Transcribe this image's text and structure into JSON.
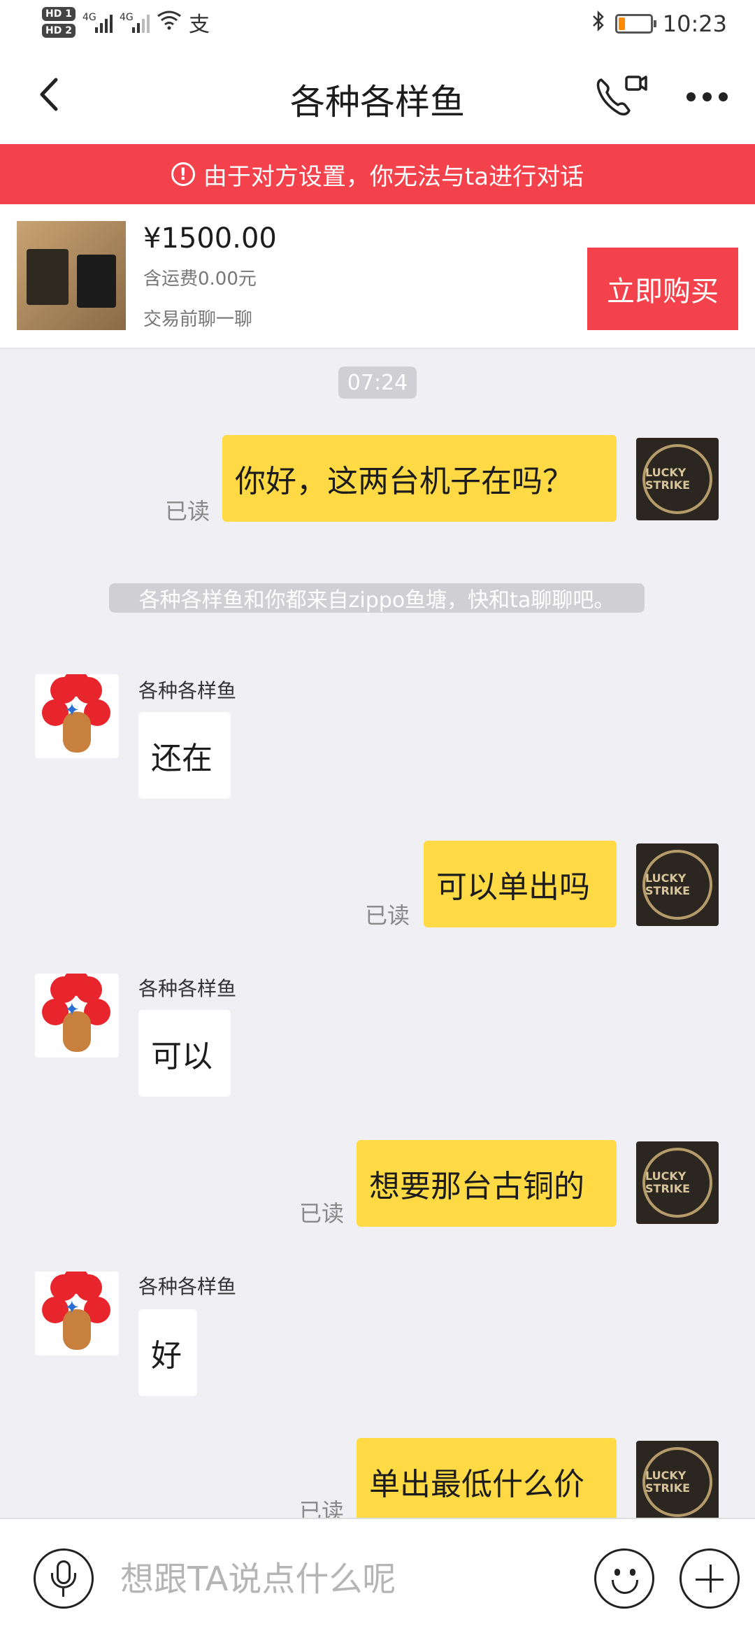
{
  "status_bar": {
    "hd1": "HD 1",
    "hd2": "HD 2",
    "net1": "4G",
    "net2": "4G",
    "alipay_glyph": "支",
    "time": "10:23",
    "battery_level": 0.2,
    "battery_color": "#ff8a00"
  },
  "header": {
    "title": "各种各样鱼",
    "icons": [
      "back-icon",
      "video-call-icon",
      "more-icon"
    ]
  },
  "banner": {
    "icon": "!",
    "text": "由于对方设置，你无法与ta进行对话",
    "color": "#f4424c"
  },
  "product": {
    "price": "¥1500.00",
    "shipping": "含运费0.00元",
    "note": "交易前聊一聊",
    "buy_label": "立即购买"
  },
  "chat": {
    "timestamp": "07:24",
    "system_message": "各种各样鱼和你都来自zippo鱼塘，快和ta聊聊吧。",
    "read_label": "已读",
    "other_name": "各种各样鱼",
    "my_avatar_text": "LUCKY STRIKE",
    "messages": [
      {
        "from": "me",
        "text": "你好，这两台机子在吗？"
      },
      {
        "from": "them",
        "text": "还在"
      },
      {
        "from": "me",
        "text": "可以单出吗"
      },
      {
        "from": "them",
        "text": "可以"
      },
      {
        "from": "me",
        "text": "想要那台古铜的"
      },
      {
        "from": "them",
        "text": "好"
      },
      {
        "from": "me",
        "text": "单出最低什么价"
      }
    ]
  },
  "input": {
    "placeholder": "想跟TA说点什么呢"
  }
}
